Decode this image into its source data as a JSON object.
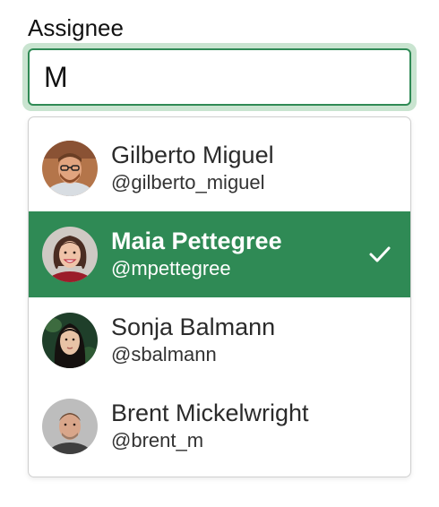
{
  "field": {
    "label": "Assignee",
    "value": "M",
    "toggle_icon": "chevron-down-icon"
  },
  "options": [
    {
      "name": "Gilberto Miguel",
      "handle": "@gilberto_miguel",
      "selected": false,
      "avatar": "avatar-photo"
    },
    {
      "name": "Maia Pettegree",
      "handle": "@mpettegree",
      "selected": true,
      "avatar": "avatar-photo"
    },
    {
      "name": "Sonja Balmann",
      "handle": "@sbalmann",
      "selected": false,
      "avatar": "avatar-photo"
    },
    {
      "name": "Brent Mickelwright",
      "handle": "@brent_m",
      "selected": false,
      "avatar": "avatar-photo"
    }
  ],
  "colors": {
    "accent": "#2f8a55",
    "focus_ring": "#c9e4d0",
    "border": "#cfcfcf"
  }
}
